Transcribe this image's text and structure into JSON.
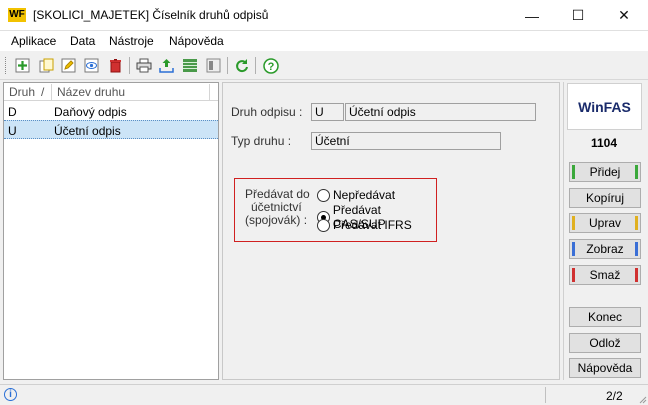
{
  "window": {
    "logo_text": "WF",
    "title": "[SKOLICI_MAJETEK] Číselník druhů odpisů",
    "min_glyph": "—",
    "max_glyph": "☐",
    "close_glyph": "✕"
  },
  "menu": [
    "Aplikace",
    "Data",
    "Nástroje",
    "Nápověda"
  ],
  "toolbar": {
    "icons": [
      "add-icon",
      "copy-icon",
      "edit-icon",
      "view-icon",
      "delete-icon",
      "print-icon",
      "export-icon",
      "grid-icon",
      "columns-icon",
      "refresh-icon",
      "help-icon"
    ]
  },
  "list": {
    "columns": [
      "Druh",
      "/",
      "Název druhu"
    ],
    "rows": [
      {
        "druh": "D",
        "nazev": "Daňový odpis"
      },
      {
        "druh": "U",
        "nazev": "Účetní odpis"
      }
    ],
    "selected_index": 1
  },
  "form": {
    "druh_label": "Druh odpisu :",
    "druh_code": "U",
    "druh_name": "Účetní odpis",
    "typ_label": "Typ druhu :",
    "typ_value": "Účetní",
    "predavat_label_1": "Předávat do",
    "predavat_label_2": "účetnictví",
    "predavat_label_3": "(spojovák) :",
    "options": [
      {
        "label": "Nepředávat",
        "checked": false
      },
      {
        "label": "Předávat CAS/SUP",
        "checked": true
      },
      {
        "label": "Předávat IFRS",
        "checked": false
      }
    ]
  },
  "side": {
    "brand": "WinFAS",
    "code": "1104",
    "buttons": [
      {
        "label": "Přidej",
        "color": "#3aa83a"
      },
      {
        "label": "Kopíruj",
        "color": ""
      },
      {
        "label": "Uprav",
        "color": "#e0b020"
      },
      {
        "label": "Zobraz",
        "color": "#3a6fd6"
      },
      {
        "label": "Smaž",
        "color": "#d03030"
      },
      {
        "label": "Konec",
        "color": ""
      },
      {
        "label": "Odlož",
        "color": ""
      },
      {
        "label": "Nápověda",
        "color": ""
      }
    ]
  },
  "status": {
    "info_glyph": "i",
    "page": "2/2"
  }
}
